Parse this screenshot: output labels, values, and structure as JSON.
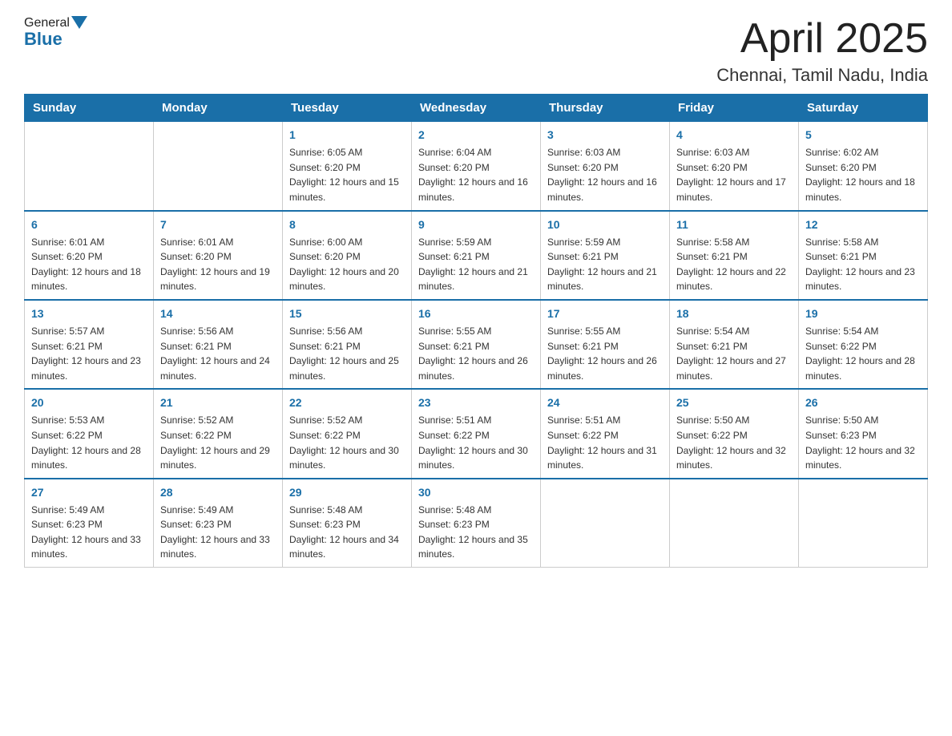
{
  "header": {
    "logo_general": "General",
    "logo_blue": "Blue",
    "title": "April 2025",
    "subtitle": "Chennai, Tamil Nadu, India"
  },
  "weekdays": [
    "Sunday",
    "Monday",
    "Tuesday",
    "Wednesday",
    "Thursday",
    "Friday",
    "Saturday"
  ],
  "weeks": [
    [
      {
        "day": "",
        "sunrise": "",
        "sunset": "",
        "daylight": ""
      },
      {
        "day": "",
        "sunrise": "",
        "sunset": "",
        "daylight": ""
      },
      {
        "day": "1",
        "sunrise": "Sunrise: 6:05 AM",
        "sunset": "Sunset: 6:20 PM",
        "daylight": "Daylight: 12 hours and 15 minutes."
      },
      {
        "day": "2",
        "sunrise": "Sunrise: 6:04 AM",
        "sunset": "Sunset: 6:20 PM",
        "daylight": "Daylight: 12 hours and 16 minutes."
      },
      {
        "day": "3",
        "sunrise": "Sunrise: 6:03 AM",
        "sunset": "Sunset: 6:20 PM",
        "daylight": "Daylight: 12 hours and 16 minutes."
      },
      {
        "day": "4",
        "sunrise": "Sunrise: 6:03 AM",
        "sunset": "Sunset: 6:20 PM",
        "daylight": "Daylight: 12 hours and 17 minutes."
      },
      {
        "day": "5",
        "sunrise": "Sunrise: 6:02 AM",
        "sunset": "Sunset: 6:20 PM",
        "daylight": "Daylight: 12 hours and 18 minutes."
      }
    ],
    [
      {
        "day": "6",
        "sunrise": "Sunrise: 6:01 AM",
        "sunset": "Sunset: 6:20 PM",
        "daylight": "Daylight: 12 hours and 18 minutes."
      },
      {
        "day": "7",
        "sunrise": "Sunrise: 6:01 AM",
        "sunset": "Sunset: 6:20 PM",
        "daylight": "Daylight: 12 hours and 19 minutes."
      },
      {
        "day": "8",
        "sunrise": "Sunrise: 6:00 AM",
        "sunset": "Sunset: 6:20 PM",
        "daylight": "Daylight: 12 hours and 20 minutes."
      },
      {
        "day": "9",
        "sunrise": "Sunrise: 5:59 AM",
        "sunset": "Sunset: 6:21 PM",
        "daylight": "Daylight: 12 hours and 21 minutes."
      },
      {
        "day": "10",
        "sunrise": "Sunrise: 5:59 AM",
        "sunset": "Sunset: 6:21 PM",
        "daylight": "Daylight: 12 hours and 21 minutes."
      },
      {
        "day": "11",
        "sunrise": "Sunrise: 5:58 AM",
        "sunset": "Sunset: 6:21 PM",
        "daylight": "Daylight: 12 hours and 22 minutes."
      },
      {
        "day": "12",
        "sunrise": "Sunrise: 5:58 AM",
        "sunset": "Sunset: 6:21 PM",
        "daylight": "Daylight: 12 hours and 23 minutes."
      }
    ],
    [
      {
        "day": "13",
        "sunrise": "Sunrise: 5:57 AM",
        "sunset": "Sunset: 6:21 PM",
        "daylight": "Daylight: 12 hours and 23 minutes."
      },
      {
        "day": "14",
        "sunrise": "Sunrise: 5:56 AM",
        "sunset": "Sunset: 6:21 PM",
        "daylight": "Daylight: 12 hours and 24 minutes."
      },
      {
        "day": "15",
        "sunrise": "Sunrise: 5:56 AM",
        "sunset": "Sunset: 6:21 PM",
        "daylight": "Daylight: 12 hours and 25 minutes."
      },
      {
        "day": "16",
        "sunrise": "Sunrise: 5:55 AM",
        "sunset": "Sunset: 6:21 PM",
        "daylight": "Daylight: 12 hours and 26 minutes."
      },
      {
        "day": "17",
        "sunrise": "Sunrise: 5:55 AM",
        "sunset": "Sunset: 6:21 PM",
        "daylight": "Daylight: 12 hours and 26 minutes."
      },
      {
        "day": "18",
        "sunrise": "Sunrise: 5:54 AM",
        "sunset": "Sunset: 6:21 PM",
        "daylight": "Daylight: 12 hours and 27 minutes."
      },
      {
        "day": "19",
        "sunrise": "Sunrise: 5:54 AM",
        "sunset": "Sunset: 6:22 PM",
        "daylight": "Daylight: 12 hours and 28 minutes."
      }
    ],
    [
      {
        "day": "20",
        "sunrise": "Sunrise: 5:53 AM",
        "sunset": "Sunset: 6:22 PM",
        "daylight": "Daylight: 12 hours and 28 minutes."
      },
      {
        "day": "21",
        "sunrise": "Sunrise: 5:52 AM",
        "sunset": "Sunset: 6:22 PM",
        "daylight": "Daylight: 12 hours and 29 minutes."
      },
      {
        "day": "22",
        "sunrise": "Sunrise: 5:52 AM",
        "sunset": "Sunset: 6:22 PM",
        "daylight": "Daylight: 12 hours and 30 minutes."
      },
      {
        "day": "23",
        "sunrise": "Sunrise: 5:51 AM",
        "sunset": "Sunset: 6:22 PM",
        "daylight": "Daylight: 12 hours and 30 minutes."
      },
      {
        "day": "24",
        "sunrise": "Sunrise: 5:51 AM",
        "sunset": "Sunset: 6:22 PM",
        "daylight": "Daylight: 12 hours and 31 minutes."
      },
      {
        "day": "25",
        "sunrise": "Sunrise: 5:50 AM",
        "sunset": "Sunset: 6:22 PM",
        "daylight": "Daylight: 12 hours and 32 minutes."
      },
      {
        "day": "26",
        "sunrise": "Sunrise: 5:50 AM",
        "sunset": "Sunset: 6:23 PM",
        "daylight": "Daylight: 12 hours and 32 minutes."
      }
    ],
    [
      {
        "day": "27",
        "sunrise": "Sunrise: 5:49 AM",
        "sunset": "Sunset: 6:23 PM",
        "daylight": "Daylight: 12 hours and 33 minutes."
      },
      {
        "day": "28",
        "sunrise": "Sunrise: 5:49 AM",
        "sunset": "Sunset: 6:23 PM",
        "daylight": "Daylight: 12 hours and 33 minutes."
      },
      {
        "day": "29",
        "sunrise": "Sunrise: 5:48 AM",
        "sunset": "Sunset: 6:23 PM",
        "daylight": "Daylight: 12 hours and 34 minutes."
      },
      {
        "day": "30",
        "sunrise": "Sunrise: 5:48 AM",
        "sunset": "Sunset: 6:23 PM",
        "daylight": "Daylight: 12 hours and 35 minutes."
      },
      {
        "day": "",
        "sunrise": "",
        "sunset": "",
        "daylight": ""
      },
      {
        "day": "",
        "sunrise": "",
        "sunset": "",
        "daylight": ""
      },
      {
        "day": "",
        "sunrise": "",
        "sunset": "",
        "daylight": ""
      }
    ]
  ]
}
